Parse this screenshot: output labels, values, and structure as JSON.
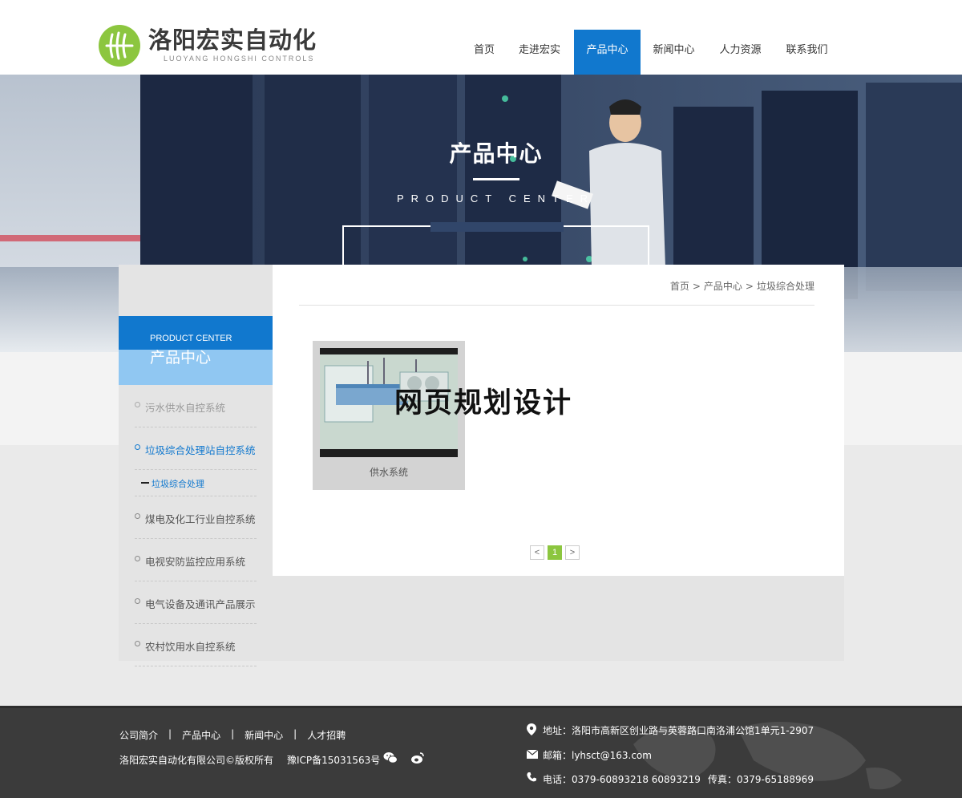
{
  "header": {
    "logo_cn": "洛阳宏实自动化",
    "logo_en": "LUOYANG HONGSHI CONTROLS",
    "nav": [
      {
        "label": "首页",
        "active": false
      },
      {
        "label": "走进宏实",
        "active": false
      },
      {
        "label": "产品中心",
        "active": true
      },
      {
        "label": "新闻中心",
        "active": false
      },
      {
        "label": "人力资源",
        "active": false
      },
      {
        "label": "联系我们",
        "active": false
      }
    ]
  },
  "banner": {
    "title_cn": "产品中心",
    "title_en": "PRODUCT CENTER"
  },
  "breadcrumb": [
    "首页",
    "产品中心",
    "垃圾综合处理"
  ],
  "breadcrumb_sep": ">",
  "sidebar": {
    "title_en": "PRODUCT CENTER",
    "title_cn": "产品中心",
    "items": [
      {
        "label": "污水供水自控系统",
        "state": "muted"
      },
      {
        "label": "垃圾综合处理站自控系统",
        "state": "active"
      },
      {
        "label": "垃圾综合处理",
        "state": "sub"
      },
      {
        "label": "煤电及化工行业自控系统",
        "state": "normal"
      },
      {
        "label": "电视安防监控应用系统",
        "state": "normal"
      },
      {
        "label": "电气设备及通讯产品展示",
        "state": "normal"
      },
      {
        "label": "农村饮用水自控系统",
        "state": "normal"
      }
    ]
  },
  "products": [
    {
      "name": "供水系统"
    }
  ],
  "watermark": "网页规划设计",
  "pagination": {
    "prev": "<",
    "current": "1",
    "next": ">"
  },
  "footer": {
    "links": [
      "公司简介",
      "产品中心",
      "新闻中心",
      "人才招聘"
    ],
    "link_sep": "|",
    "copyright": "洛阳宏实自动化有限公司©版权所有",
    "icp": "豫ICP备15031563号",
    "address": "地址：洛阳市高新区创业路与英蓉路口南洛浦公馆1单元1-2907",
    "email": "邮箱：lyhsct@163.com",
    "phone": "电话：0379-60893218 60893219",
    "fax": "传真：0379-65188969"
  },
  "colors": {
    "brand_blue": "#1178ce",
    "brand_green": "#8cc63f",
    "footer_bg": "#3b3b3b"
  }
}
